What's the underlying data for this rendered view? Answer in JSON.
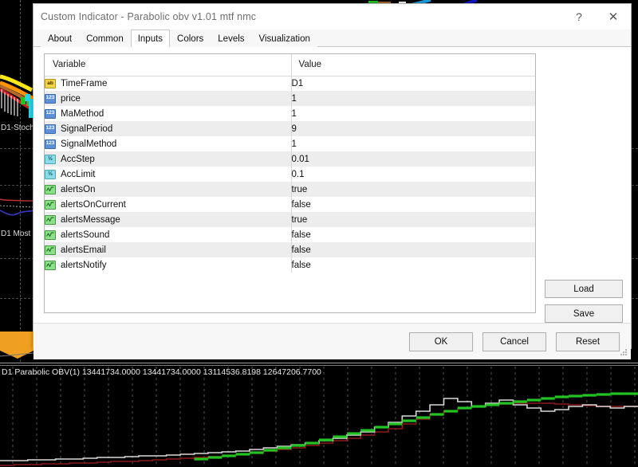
{
  "dialog": {
    "title": "Custom Indicator - Parabolic obv v1.01 mtf nmc",
    "help_label": "?",
    "close_label": "✕",
    "tabs": [
      {
        "label": "About",
        "active": false
      },
      {
        "label": "Common",
        "active": false
      },
      {
        "label": "Inputs",
        "active": true
      },
      {
        "label": "Colors",
        "active": false
      },
      {
        "label": "Levels",
        "active": false
      },
      {
        "label": "Visualization",
        "active": false
      }
    ],
    "table": {
      "headers": [
        "Variable",
        "Value"
      ],
      "rows": [
        {
          "icon": "string-type-icon",
          "kind": "string",
          "glyph": "ab",
          "variable": "TimeFrame",
          "value": "D1"
        },
        {
          "icon": "int-type-icon",
          "kind": "int",
          "glyph": "123",
          "variable": "price",
          "value": "1"
        },
        {
          "icon": "int-type-icon",
          "kind": "int",
          "glyph": "123",
          "variable": "MaMethod",
          "value": "1"
        },
        {
          "icon": "int-type-icon",
          "kind": "int",
          "glyph": "123",
          "variable": "SignalPeriod",
          "value": "9"
        },
        {
          "icon": "int-type-icon",
          "kind": "int",
          "glyph": "123",
          "variable": "SignalMethod",
          "value": "1"
        },
        {
          "icon": "double-type-icon",
          "kind": "dbl",
          "glyph": "½",
          "variable": "AccStep",
          "value": "0.01"
        },
        {
          "icon": "double-type-icon",
          "kind": "dbl",
          "glyph": "½",
          "variable": "AccLimit",
          "value": "0.1"
        },
        {
          "icon": "bool-type-icon",
          "kind": "bool",
          "glyph": "",
          "variable": "alertsOn",
          "value": "true"
        },
        {
          "icon": "bool-type-icon",
          "kind": "bool",
          "glyph": "",
          "variable": "alertsOnCurrent",
          "value": "false"
        },
        {
          "icon": "bool-type-icon",
          "kind": "bool",
          "glyph": "",
          "variable": "alertsMessage",
          "value": "true"
        },
        {
          "icon": "bool-type-icon",
          "kind": "bool",
          "glyph": "",
          "variable": "alertsSound",
          "value": "false"
        },
        {
          "icon": "bool-type-icon",
          "kind": "bool",
          "glyph": "",
          "variable": "alertsEmail",
          "value": "false"
        },
        {
          "icon": "bool-type-icon",
          "kind": "bool",
          "glyph": "",
          "variable": "alertsNotify",
          "value": "false"
        }
      ]
    },
    "side_buttons": [
      {
        "label": "Load"
      },
      {
        "label": "Save"
      }
    ],
    "footer_buttons": [
      {
        "label": "OK"
      },
      {
        "label": "Cancel"
      },
      {
        "label": "Reset"
      }
    ]
  },
  "background_chart": {
    "pane_labels": [
      {
        "text": "D1-Stoch("
      },
      {
        "text": "D1 Most ("
      }
    ],
    "obv_status": "D1 Parabolic OBV(1) 13441734.0000 13441734.0000 13114536.8198 12647206.7700",
    "colors": {
      "background": "#000000",
      "grid": "#555555",
      "obv_main": "#d9d9d9",
      "obv_signal": "#8b1a1a",
      "obv_trend_up": "#22c322",
      "ma_yellow": "#ffe81a",
      "ma_orange": "#ff9500",
      "ma_red": "#c81e1e",
      "candle_cyan": "#27d5e8",
      "band_orange": "#f0a020",
      "stoch_red": "#b03030",
      "stoch_blue": "#3a3ac8"
    }
  }
}
